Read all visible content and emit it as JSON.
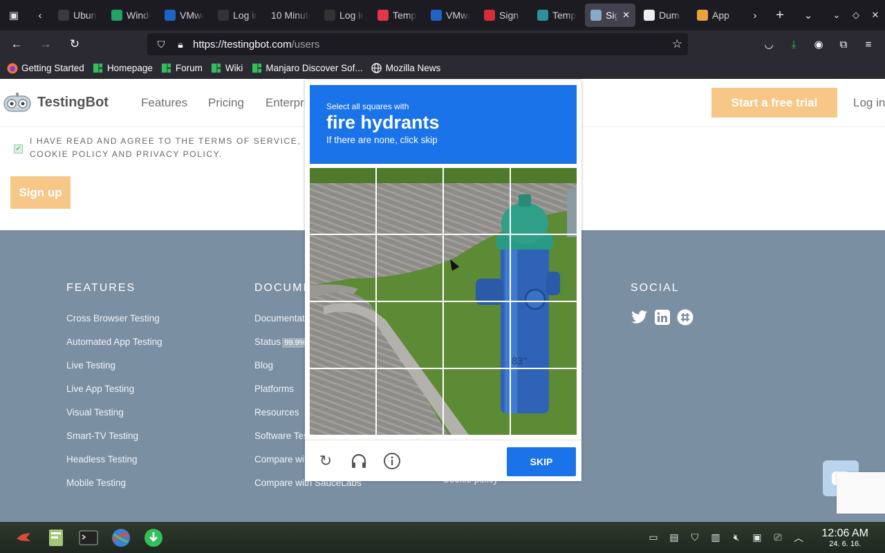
{
  "browser": {
    "tabs": [
      {
        "title": "Ubuntu",
        "favicon": "ubuntu-icon",
        "color": "#3a3a3a"
      },
      {
        "title": "Windows",
        "favicon": "sheet-icon",
        "color": "#1fa463"
      },
      {
        "title": "VMware",
        "favicon": "vmware-icon",
        "color": "#1e64c8"
      },
      {
        "title": "Log in",
        "favicon": "vm-icon",
        "color": "#333"
      },
      {
        "title": "10 Minute",
        "favicon": "",
        "color": ""
      },
      {
        "title": "Log in",
        "favicon": "vm-icon",
        "color": "#333"
      },
      {
        "title": "Temp",
        "favicon": "mail-icon",
        "color": "#e2364a"
      },
      {
        "title": "VMware",
        "favicon": "vmware-icon",
        "color": "#1e64c8"
      },
      {
        "title": "Sign",
        "favicon": "pulse-icon",
        "color": "#d62d3b"
      },
      {
        "title": "Temp",
        "favicon": "temp-icon",
        "color": "#2f8f9d"
      },
      {
        "title": "Sign",
        "favicon": "testingbot-icon",
        "color": "#8aa9c7",
        "active": true
      },
      {
        "title": "Dum",
        "favicon": "dummy-icon",
        "color": "#eee"
      },
      {
        "title": "App",
        "favicon": "chrome-icon",
        "color": "#e8a33a"
      }
    ],
    "url_host": "https://testingbot.com",
    "url_path": "/users",
    "bookmarks": [
      {
        "label": "Getting Started",
        "icon": "firefox-icon",
        "color": "#ff7139"
      },
      {
        "label": "Homepage",
        "icon": "manjaro-icon",
        "color": "#35bf5c"
      },
      {
        "label": "Forum",
        "icon": "manjaro-icon",
        "color": "#35bf5c"
      },
      {
        "label": "Wiki",
        "icon": "manjaro-icon",
        "color": "#35bf5c"
      },
      {
        "label": "Manjaro Discover Sof...",
        "icon": "manjaro-icon",
        "color": "#35bf5c"
      },
      {
        "label": "Mozilla News",
        "icon": "globe-icon",
        "color": "#fbfbfe"
      }
    ]
  },
  "site": {
    "logo": "TestingBot",
    "nav": [
      "Features",
      "Pricing",
      "Enterprise"
    ],
    "cta": "Start a free trial",
    "login": "Log in",
    "terms_text": "I have read and agree to the Terms of Service, Cookie Policy and Privacy Policy.",
    "signup": "Sign up",
    "accent_color": "#f7c788",
    "footer_color": "#7b8fa3"
  },
  "footer": {
    "features": {
      "title": "FEATURES",
      "links": [
        "Cross Browser Testing",
        "Automated App Testing",
        "Live Testing",
        "Live App Testing",
        "Visual Testing",
        "Smart-TV Testing",
        "Headless Testing",
        "Mobile Testing"
      ]
    },
    "documentation": {
      "title": "DOCUMENTATION",
      "links": [
        "Documentation",
        "Status",
        "Blog",
        "Platforms",
        "Resources",
        "Software Testing",
        "Compare with BrowserStack",
        "Compare with SauceLabs"
      ],
      "status_badge": "99.9%"
    },
    "company": {
      "links": [
        "Cookie policy"
      ]
    },
    "social": {
      "title": "SOCIAL",
      "icons": [
        "twitter-icon",
        "linkedin-icon",
        "slack-icon"
      ]
    }
  },
  "captcha": {
    "instruction_small": "Select all squares with",
    "target": "fire hydrants",
    "instruction_sub": "If there are none, click skip",
    "skip_label": "SKIP",
    "footer_icons": [
      "reload-icon",
      "audio-icon",
      "info-icon"
    ],
    "accent_color": "#1a73e8"
  },
  "taskbar": {
    "time": "12:06 AM",
    "date": "24. 6. 16."
  }
}
